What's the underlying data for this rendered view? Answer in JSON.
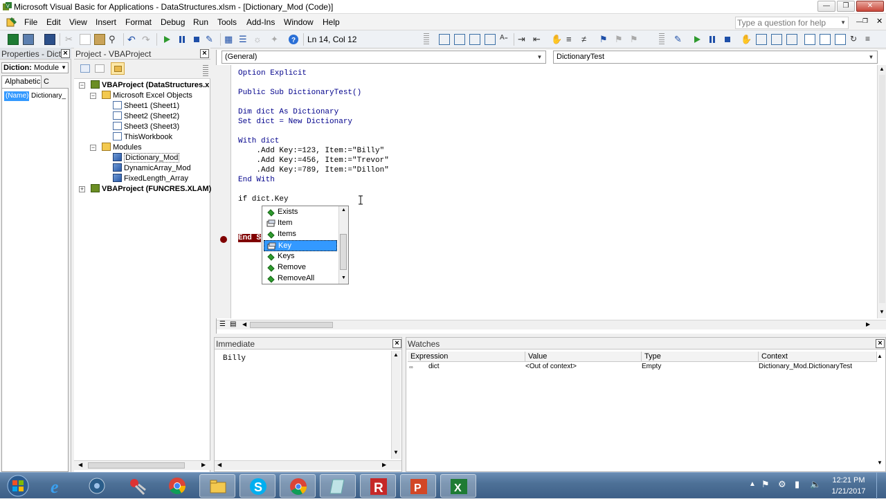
{
  "window": {
    "title": "Microsoft Visual Basic for Applications - DataStructures.xlsm - [Dictionary_Mod (Code)]"
  },
  "menu": [
    "File",
    "Edit",
    "View",
    "Insert",
    "Format",
    "Debug",
    "Run",
    "Tools",
    "Add-Ins",
    "Window",
    "Help"
  ],
  "help_box": {
    "placeholder": "Type a question for help"
  },
  "toolbar": {
    "position_label": "Ln 14, Col 12"
  },
  "properties_pane": {
    "title": "Properties - Dictio",
    "object_name": "Diction:",
    "object_type": "Module",
    "tabs": [
      "Alphabetic",
      "C"
    ],
    "row_name": "(Name)",
    "row_value": "Dictionary_"
  },
  "project_pane": {
    "title": "Project - VBAProject",
    "tree": [
      {
        "label": "VBAProject (DataStructures.x",
        "level": 0,
        "bold": true
      },
      {
        "label": "Microsoft Excel Objects",
        "level": 1
      },
      {
        "label": "Sheet1 (Sheet1)",
        "level": 2
      },
      {
        "label": "Sheet2 (Sheet2)",
        "level": 2
      },
      {
        "label": "Sheet3 (Sheet3)",
        "level": 2
      },
      {
        "label": "ThisWorkbook",
        "level": 2
      },
      {
        "label": "Modules",
        "level": 1
      },
      {
        "label": "Dictionary_Mod",
        "level": 2,
        "selected": true
      },
      {
        "label": "DynamicArray_Mod",
        "level": 2
      },
      {
        "label": "FixedLength_Array",
        "level": 2
      },
      {
        "label": "VBAProject (FUNCRES.XLAM)",
        "level": 0,
        "bold": true
      }
    ]
  },
  "code_window": {
    "object_combo": "(General)",
    "proc_combo": "DictionaryTest",
    "lines": [
      "Option Explicit",
      "",
      "Public Sub DictionaryTest()",
      "",
      "Dim dict As Dictionary",
      "Set dict = New Dictionary",
      "",
      "With dict",
      "    .Add Key:=123, Item:=\"Billy\"",
      "    .Add Key:=456, Item:=\"Trevor\"",
      "    .Add Key:=789, Item:=\"Dillon\"",
      "End With",
      "",
      "if dict.Key",
      "",
      "",
      "End S"
    ],
    "autocomplete": [
      {
        "label": "Exists",
        "icon": "method-icon"
      },
      {
        "label": "Item",
        "icon": "property-icon"
      },
      {
        "label": "Items",
        "icon": "method-icon"
      },
      {
        "label": "Key",
        "icon": "property-icon",
        "selected": true
      },
      {
        "label": "Keys",
        "icon": "method-icon"
      },
      {
        "label": "Remove",
        "icon": "method-icon"
      },
      {
        "label": "RemoveAll",
        "icon": "method-icon"
      }
    ]
  },
  "immediate": {
    "title": "Immediate",
    "content": "Billy"
  },
  "watches": {
    "title": "Watches",
    "columns": [
      "Expression",
      "Value",
      "Type",
      "Context"
    ],
    "rows": [
      {
        "expression": "dict",
        "value": "<Out of context>",
        "type": "Empty",
        "context": "Dictionary_Mod.DictionaryTest"
      }
    ]
  },
  "taskbar": {
    "time": "12:21 PM",
    "date": "1/21/2017"
  },
  "colors": {
    "selection": "#3399ff",
    "breakpoint": "#800000",
    "taskbar": "#4e7197"
  }
}
